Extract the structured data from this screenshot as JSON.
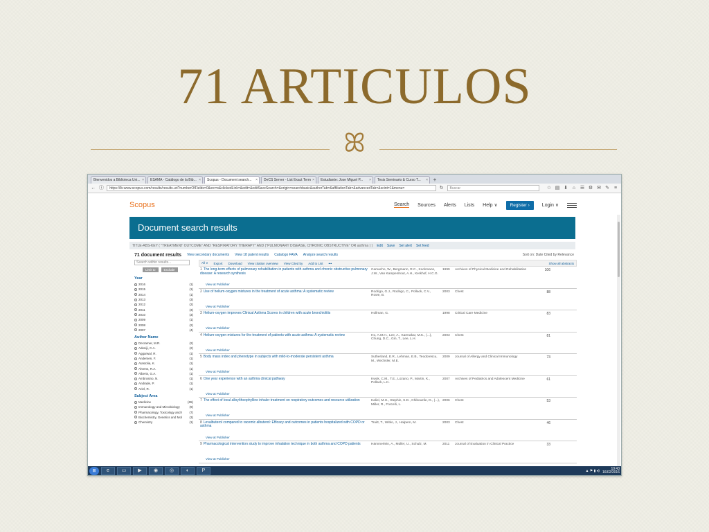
{
  "slide": {
    "title": "71 ARTICULOS",
    "ornament": "ꕤ",
    "colors": {
      "title": "#8c6a2c",
      "divider": "#b68f4d",
      "background": "#f0efe6"
    }
  },
  "browser": {
    "tabs": [
      {
        "label": "Bienvenidos a Biblioteca Uni...",
        "close": "×"
      },
      {
        "label": "ESAMA - Catálogo de la Bib...",
        "close": "×"
      },
      {
        "label": "Scopus - Document search...",
        "close": "×"
      },
      {
        "label": "DeCS Server - List Exact Term",
        "close": "×"
      },
      {
        "label": "Estudiante: Jose Miguel P...",
        "close": "×"
      },
      {
        "label": "Tesis Seminario & Curso T...",
        "close": "×"
      }
    ],
    "new_tab": "+",
    "nav_icons": {
      "back": "←",
      "info": "ⓘ",
      "reload": "↻"
    },
    "url": "https://lb-www.scopus.com/results/results.uri?numberOfFields=0&src=s&clickedLink=&edit=&editSaveSearch=&origin=searchbasic&authorTab=&affiliationTab=&advancedTab=&scint=1&menu=",
    "search_placeholder": "Buscar",
    "toolbar_icons": [
      "☆",
      "▤",
      "⬇",
      "⌂",
      "☰",
      "⚙",
      "✉",
      "✎",
      "≡"
    ]
  },
  "scopus": {
    "logo": "Scopus",
    "nav": [
      "Search",
      "Sources",
      "Alerts",
      "Lists",
      "Help ∨"
    ],
    "register": "Register ›",
    "login": "Login ∨",
    "banner": "Document search results",
    "query": "TITLE-ABS-KEY ( \"TREATMENT OUTCOME\" AND \"RESPIRATORY THERAPY\" AND (\"PULMONARY DISEASE, CHRONIC OBSTRUCTIVE\" OR asthma ) )",
    "query_actions": [
      "Edit",
      "Save",
      "Set alert",
      "Set feed"
    ],
    "results_count": "71 document results",
    "results_links": [
      "View secondary documents",
      "View 18 patent results",
      "Catalogo FAVA",
      "Analyze search results"
    ],
    "sort_by": "Sort on: Date  Cited by  Relevance",
    "show_all": "Show all abstracts",
    "search_within": "Search within results...",
    "limit_buttons": [
      "Limit to",
      "Exclude"
    ],
    "toolbar": [
      "All ∨",
      "Export",
      "Download",
      "View citation overview",
      "View Cited by",
      "Add to List",
      "•••"
    ],
    "columns": [
      "Document title",
      "Authors",
      "Year",
      "Source",
      "Cited by"
    ],
    "view_abstract": "View at Publisher",
    "facets": [
      {
        "title": "Year",
        "items": [
          {
            "label": "2016",
            "count": "(1)"
          },
          {
            "label": "2015",
            "count": "(1)"
          },
          {
            "label": "2014",
            "count": "(1)"
          },
          {
            "label": "2013",
            "count": "(3)"
          },
          {
            "label": "2012",
            "count": "(2)"
          },
          {
            "label": "2011",
            "count": "(3)"
          },
          {
            "label": "2010",
            "count": "(3)"
          },
          {
            "label": "2009",
            "count": "(1)"
          },
          {
            "label": "2008",
            "count": "(2)"
          },
          {
            "label": "2007",
            "count": "(4)"
          }
        ]
      },
      {
        "title": "Author Name",
        "items": [
          {
            "label": "Decramer, M.R.",
            "count": "(2)"
          },
          {
            "label": "Adeniji, C.A.",
            "count": "(2)"
          },
          {
            "label": "Aggarwal, R.",
            "count": "(1)"
          },
          {
            "label": "Andersen, F.",
            "count": "(1)"
          },
          {
            "label": "Atastolia, K.",
            "count": "(1)"
          },
          {
            "label": "Ahrens, R.A.",
            "count": "(1)"
          },
          {
            "label": "Alberts, G.A.",
            "count": "(1)"
          },
          {
            "label": "Ambrosino, N.",
            "count": "(1)"
          },
          {
            "label": "Andrade, P.",
            "count": "(1)"
          },
          {
            "label": "Ariel, R.",
            "count": "(1)"
          }
        ]
      },
      {
        "title": "Subject Area",
        "items": [
          {
            "label": "Medicine",
            "count": "(65)"
          },
          {
            "label": "Immunology and Microbiology",
            "count": "(9)"
          },
          {
            "label": "Pharmacology, Toxicology and Pharmaceutics",
            "count": "(7)"
          },
          {
            "label": "Biochemistry, Genetics and Molecular Biology",
            "count": "(3)"
          },
          {
            "label": "Chemistry",
            "count": "(1)"
          }
        ]
      }
    ],
    "results": [
      {
        "num": "1",
        "title": "The long-term effects of pulmonary rehabilitation in patients with asthma and chronic obstructive pulmonary disease: A research synthesis",
        "authors": "Camacho, W., Bergmann, R.C., Kockmann, J.W., Van Kampenhout, A.H., Kerkhof, H.C.G.",
        "year": "1999",
        "source": "Archives of Physical Medicine and Rehabilitation",
        "cited": "106"
      },
      {
        "num": "2",
        "title": "Use of helium-oxygen mixtures in the treatment of acute asthma: A systematic review",
        "authors": "Rodrigo, G.J., Rodrigo, C., Pollack, C.V., Rowe, B.",
        "year": "2003",
        "source": "Chest",
        "cited": "88"
      },
      {
        "num": "3",
        "title": "Helium-oxygen improves Clinical Asthma Scores in children with acute bronchiolitis",
        "authors": "Hollman, G.",
        "year": "1998",
        "source": "Critical Care Medicine",
        "cited": "83"
      },
      {
        "num": "4",
        "title": "Helium-oxygen mixtures for the treatment of patients with acute asthma: A systematic review",
        "authors": "Ho, A.M.H., Lee, A., Karmakar, M.K., (...), Chung, D.C., Gin, T., Lee, L.H.",
        "year": "2003",
        "source": "Chest",
        "cited": "81"
      },
      {
        "num": "5",
        "title": "Body mass index and phenotype in subjects with mild-to-moderate persistent asthma",
        "authors": "Sutherland, E.R., Lehman, E.B., Teodorescu, M., Wechsler, M.E.",
        "year": "2009",
        "source": "Journal of Allergy and Clinical Immunology",
        "cited": "73"
      },
      {
        "num": "6",
        "title": "One year experience with an asthma clinical pathway",
        "authors": "Kwok, C.M., T.E., Lozano, P., Martin, K., Pollack, L.K.",
        "year": "2007",
        "source": "Archives of Pediatrics and Adolescent Medicine",
        "cited": "61"
      },
      {
        "num": "7",
        "title": "The effect of local alloy/theophylline inhaler treatment on respiratory outcomes and resource utilization",
        "authors": "Kaliel, M.H., Stephin, S.D., Chibouzile, D., (...), Miller, R., Forcelli, L.",
        "year": "2006",
        "source": "Chest",
        "cited": "53"
      },
      {
        "num": "8",
        "title": "Levalbuterol compared to racemic albuterol: Efficacy and outcomes in patients hospitalized with COPD or asthma",
        "authors": "Truitt, T., Witko, J., Halpern, M.",
        "year": "2003",
        "source": "Chest",
        "cited": "46"
      },
      {
        "num": "9",
        "title": "Pharmacological intervention study to improve inhalation technique in both asthma and COPD patients",
        "authors": "Hämmerlein, A., Müller, U., Schulz, M.",
        "year": "2011",
        "source": "Journal of Evaluation in Clinical Practice",
        "cited": "33"
      }
    ]
  },
  "taskbar": {
    "start": "⊞",
    "apps": [
      "e",
      "▭",
      "▶",
      "◉",
      "◎",
      "◐",
      "P"
    ],
    "tray_icons": "▲ ⚑ ▮ ◂)",
    "time": "10:43",
    "date": "16/02/2016"
  }
}
